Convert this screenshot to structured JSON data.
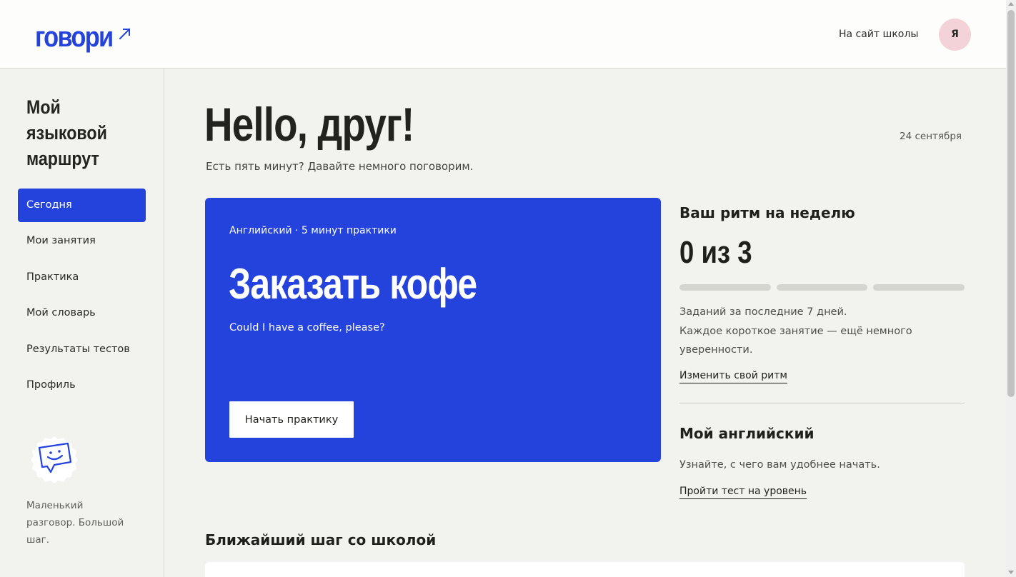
{
  "header": {
    "logo_text": "говори",
    "site_link": "На сайт школы",
    "avatar_initial": "Я"
  },
  "sidebar": {
    "title": "Мой языковой маршрут",
    "items": [
      {
        "label": "Сегодня",
        "active": true
      },
      {
        "label": "Мои занятия",
        "active": false
      },
      {
        "label": "Практика",
        "active": false
      },
      {
        "label": "Мой словарь",
        "active": false
      },
      {
        "label": "Результаты тестов",
        "active": false
      },
      {
        "label": "Профиль",
        "active": false
      }
    ],
    "mascot_icon": "chat-smile-icon",
    "tagline": "Маленький разговор. Большой шаг."
  },
  "main": {
    "greeting": "Hello, друг!",
    "date": "24 сентября",
    "subtitle": "Есть пять минут? Давайте немного поговорим."
  },
  "hero": {
    "meta": "Английский · 5 минут практики",
    "title": "Заказать кофе",
    "phrase": "Could I have a coffee, please?",
    "button": "Начать практику"
  },
  "rhythm": {
    "title": "Ваш ритм на неделю",
    "count": "0 из 3",
    "completed": 0,
    "goal": 3,
    "note_line1": "Заданий за последние 7 дней.",
    "note_line2": "Каждое короткое занятие — ещё немного уверенности.",
    "link": "Изменить свой ритм"
  },
  "english": {
    "title": "Мой английский",
    "note": "Узнайте, с чего вам удобнее начать.",
    "link": "Пройти тест на уровень"
  },
  "next_step": {
    "title": "Ближайший шаг со школой"
  },
  "colors": {
    "accent": "#2443dd",
    "background": "#f2f2ef",
    "avatar_bg": "#f3d3d8"
  }
}
